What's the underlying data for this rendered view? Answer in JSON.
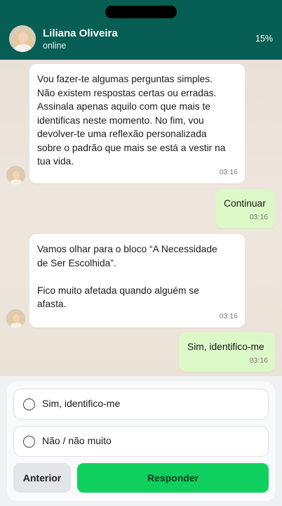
{
  "header": {
    "contact_name": "Liliana Oliveira",
    "status": "online",
    "progress": "15%",
    "background_color": "#075e54"
  },
  "messages": [
    {
      "direction": "incoming",
      "text": "Vou fazer-te algumas perguntas simples.\nNão existem respostas certas ou erradas.\nAssinala apenas aquilo com que mais te\nidentificas neste momento. No fim, vou\ndevolver-te uma reflexão personalizada\nsobre o padrão que mais se está a vestir na\ntua vida.",
      "time": "03:16"
    },
    {
      "direction": "outgoing",
      "text": "Continuar",
      "time": "03:16"
    },
    {
      "direction": "incoming",
      "text": "Vamos olhar para o bloco “A Necessidade\nde Ser Escolhida”.\n\nFico muito afetada quando alguém se\nafasta.",
      "time": "03:16"
    },
    {
      "direction": "outgoing",
      "text": "Sim, identifico-me",
      "time": "03:16"
    }
  ],
  "answers": {
    "options": [
      {
        "label": "Sim, identifico-me"
      },
      {
        "label": "Não / não muito"
      }
    ],
    "back_label": "Anterior",
    "submit_label": "Responder",
    "submit_color": "#0fd05e"
  },
  "icons": [
    "contact-avatar-icon",
    "radio-icon"
  ]
}
